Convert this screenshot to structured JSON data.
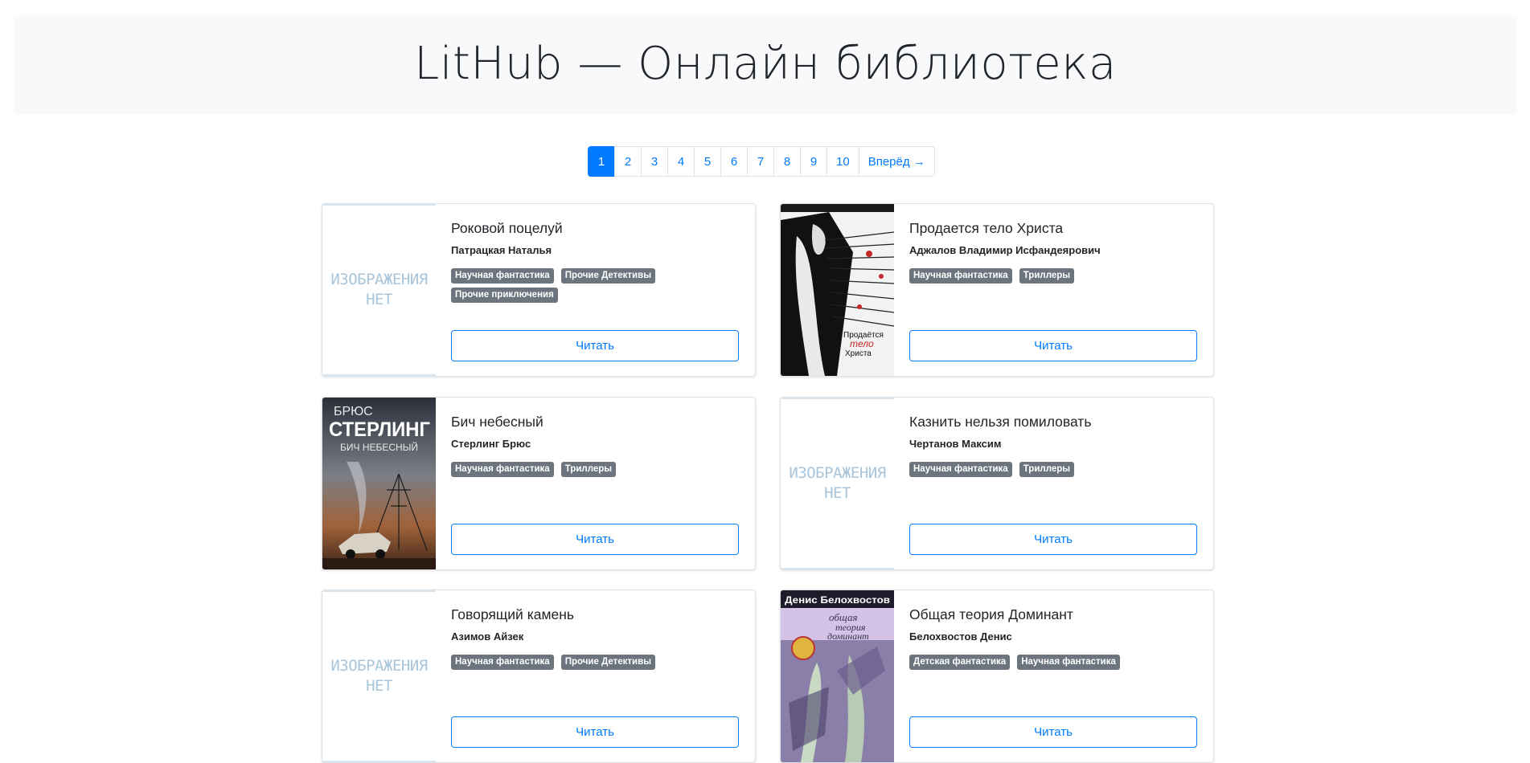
{
  "header": {
    "title": "LitHub — Онлайн библиотека"
  },
  "pagination": {
    "pages": [
      "1",
      "2",
      "3",
      "4",
      "5",
      "6",
      "7",
      "8",
      "9",
      "10"
    ],
    "active": "1",
    "next_label": "Вперёд →"
  },
  "no_image_text": "ИЗОБРАЖЕНИЯ\nНЕТ",
  "books": [
    {
      "title": "Роковой поцелуй",
      "author": "Патрацкая Наталья",
      "tags": [
        "Научная фантастика",
        "Прочие Детективы",
        "Прочие приключения"
      ],
      "cover": "no-image",
      "button": "Читать"
    },
    {
      "title": "Продается тело Христа",
      "author": "Аджалов Владимир Исфандеярович",
      "tags": [
        "Научная фантастика",
        "Триллеры"
      ],
      "cover": "cover-art",
      "cover_texts": [
        "Продаётся",
        "тело",
        "Христа"
      ],
      "button": "Читать"
    },
    {
      "title": "Бич небесный",
      "author": "Стерлинг Брюс",
      "tags": [
        "Научная фантастика",
        "Триллеры"
      ],
      "cover": "cover-art",
      "cover_texts": [
        "БРЮС",
        "СТЕРЛИНГ",
        "БИЧ НЕБЕСНЫЙ"
      ],
      "button": "Читать"
    },
    {
      "title": "Казнить нельзя помиловать",
      "author": "Чертанов Максим",
      "tags": [
        "Научная фантастика",
        "Триллеры"
      ],
      "cover": "no-image",
      "button": "Читать"
    },
    {
      "title": "Говорящий камень",
      "author": "Азимов Айзек",
      "tags": [
        "Научная фантастика",
        "Прочие Детективы"
      ],
      "cover": "no-image",
      "button": "Читать"
    },
    {
      "title": "Общая теория Доминант",
      "author": "Белохвостов Денис",
      "tags": [
        "Детская фантастика",
        "Научная фантастика"
      ],
      "cover": "cover-art",
      "cover_texts": [
        "Денис Белохвостов",
        "общая",
        "теория",
        "доминант"
      ],
      "button": "Читать"
    }
  ],
  "colors": {
    "primary": "#007bff",
    "tag": "#6c757d",
    "jumbotron": "#f8f9fa"
  }
}
